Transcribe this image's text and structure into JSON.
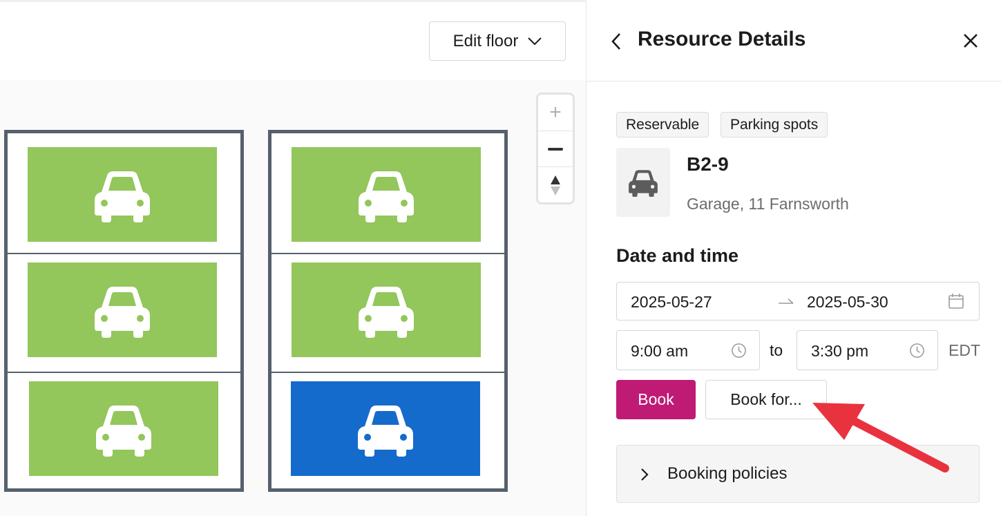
{
  "toolbar": {
    "edit_floor_label": "Edit floor"
  },
  "zoom": {
    "plus": "+",
    "compass": "▲"
  },
  "map": {
    "spots": [
      {
        "status": "available",
        "color": "#93c65b"
      },
      {
        "status": "available",
        "color": "#93c65b"
      },
      {
        "status": "available",
        "color": "#93c65b"
      },
      {
        "status": "available",
        "color": "#93c65b"
      },
      {
        "status": "available",
        "color": "#93c65b"
      },
      {
        "status": "selected",
        "color": "#146bcc"
      }
    ]
  },
  "panel": {
    "title": "Resource Details",
    "tags": [
      "Reservable",
      "Parking spots"
    ],
    "resource": {
      "name": "B2-9",
      "location": "Garage, 11 Farnsworth",
      "icon": "car-icon"
    },
    "date_time": {
      "heading": "Date and time",
      "start_date": "2025-05-27",
      "end_date": "2025-05-30",
      "start_time": "9:00 am",
      "to_label": "to",
      "end_time": "3:30 pm",
      "timezone": "EDT"
    },
    "actions": {
      "book_label": "Book",
      "book_for_label": "Book for..."
    },
    "policies": {
      "label": "Booking policies"
    }
  },
  "colors": {
    "accent": "#bf1b74",
    "available": "#93c65b",
    "selected": "#146bcc",
    "annotation": "#e8333f"
  }
}
